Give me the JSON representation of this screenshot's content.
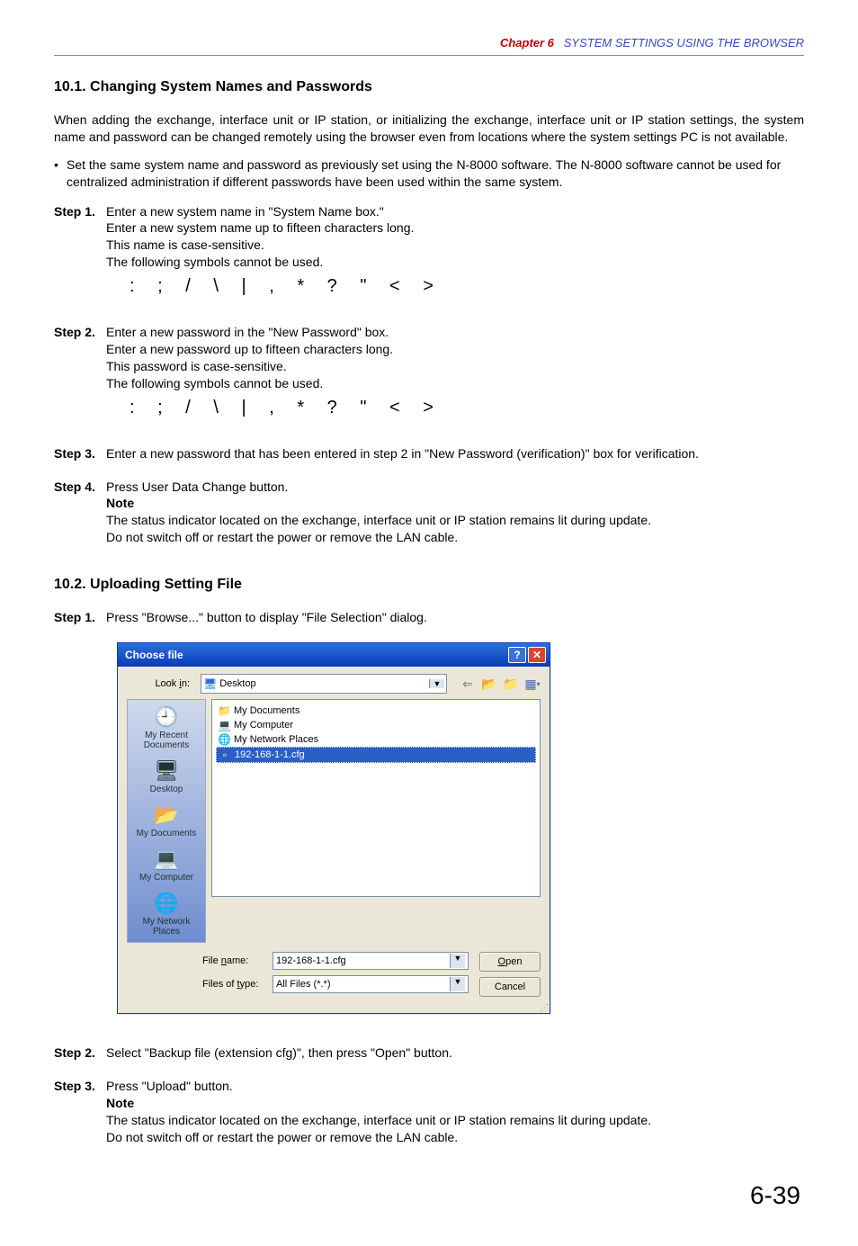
{
  "header": {
    "chapter_label": "Chapter 6",
    "chapter_title": "SYSTEM SETTINGS USING THE BROWSER"
  },
  "section1": {
    "heading": "10.1. Changing System Names and Passwords",
    "intro": "When adding the exchange, interface unit or IP station, or initializing the exchange, interface unit or IP station settings, the system name and password can be changed remotely using the browser even from locations where the system settings PC is not available.",
    "bullet": "Set the same system name and password as previously set using the N-8000 software. The N-8000 software cannot be used for centralized administration if different passwords have been used within the same system.",
    "step1_label": "Step 1.",
    "step1_l1": "Enter a new system name in \"System Name box.\"",
    "step1_l2": "Enter a new system name up to fifteen characters long.",
    "step1_l3": "This name is case-sensitive.",
    "step1_l4": "The following symbols cannot be used.",
    "symbols": ": ; / \\ | , * ? \" < >",
    "step2_label": "Step 2.",
    "step2_l1": "Enter a new password in the \"New Password\" box.",
    "step2_l2": "Enter a new password up to fifteen characters long.",
    "step2_l3": "This password is case-sensitive.",
    "step2_l4": "The following symbols cannot be used.",
    "step3_label": "Step 3.",
    "step3_body": "Enter a new password that has been entered in step 2 in \"New Password (verification)\" box for verification.",
    "step4_label": "Step 4.",
    "step4_l1": "Press User Data Change button.",
    "note_label": "Note",
    "note_l1": "The status indicator located on the exchange, interface unit or IP station remains lit during update.",
    "note_l2": "Do not switch off or restart the power or remove the LAN cable."
  },
  "section2": {
    "heading": "10.2. Uploading Setting File",
    "step1_label": "Step 1.",
    "step1_body": "Press \"Browse...\" button to display \"File Selection\" dialog.",
    "step2_label": "Step 2.",
    "step2_body": "Select \"Backup file (extension cfg)\", then press \"Open\" button.",
    "step3_label": "Step 3.",
    "step3_body": "Press \"Upload\" button.",
    "note_label": "Note",
    "note_l1": "The status indicator located on the exchange, interface unit or IP station remains lit during update.",
    "note_l2": "Do not switch off or restart the power or remove the LAN cable."
  },
  "dialog": {
    "title": "Choose file",
    "look_in_label": "Look in:",
    "look_in_value": "Desktop",
    "places": {
      "recent": "My Recent Documents",
      "desktop": "Desktop",
      "mydocs": "My Documents",
      "mycomp": "My Computer",
      "mynet": "My Network Places"
    },
    "files": {
      "f1": "My Documents",
      "f2": "My Computer",
      "f3": "My Network Places",
      "f4": "192-168-1-1.cfg"
    },
    "filename_label": "File name:",
    "filename_value": "192-168-1-1.cfg",
    "filetype_label": "Files of type:",
    "filetype_value": "All Files (*.*)",
    "open_btn": "Open",
    "cancel_btn": "Cancel"
  },
  "page_number": "6-39"
}
